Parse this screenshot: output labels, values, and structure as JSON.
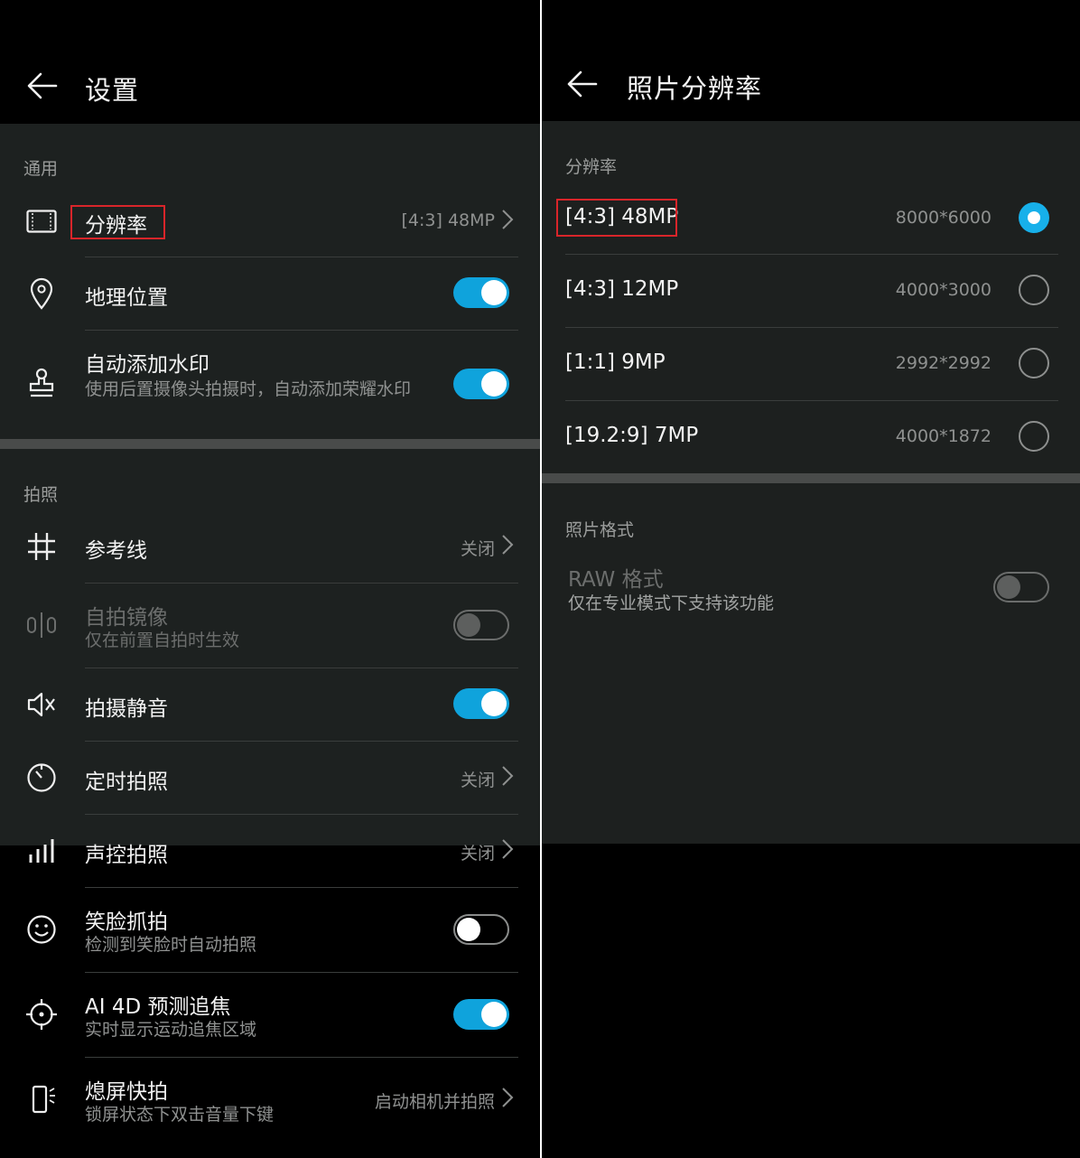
{
  "left": {
    "title": "设置",
    "sections": {
      "general": "通用",
      "photo": "拍照"
    },
    "rows": {
      "resolution": {
        "label": "分辨率",
        "value": "[4:3] 48MP"
      },
      "location": {
        "label": "地理位置",
        "toggle": "on"
      },
      "watermark": {
        "label": "自动添加水印",
        "sub": "使用后置摄像头拍摄时，自动添加荣耀水印",
        "toggle": "on"
      },
      "gridlines": {
        "label": "参考线",
        "value": "关闭"
      },
      "mirror": {
        "label": "自拍镜像",
        "sub": "仅在前置自拍时生效",
        "toggle": "off-disabled"
      },
      "mute": {
        "label": "拍摄静音",
        "toggle": "on"
      },
      "timer": {
        "label": "定时拍照",
        "value": "关闭"
      },
      "voice": {
        "label": "声控拍照",
        "value": "关闭"
      },
      "smile": {
        "label": "笑脸抓拍",
        "sub": "检测到笑脸时自动拍照",
        "toggle": "off"
      },
      "ai_focus": {
        "label": "AI 4D 预测追焦",
        "sub": "实时显示运动追焦区域",
        "toggle": "on"
      },
      "quick_snap": {
        "label": "熄屏快拍",
        "sub": "锁屏状态下双击音量下键",
        "value": "启动相机并拍照"
      }
    }
  },
  "right": {
    "title": "照片分辨率",
    "sections": {
      "resolution": "分辨率",
      "format": "照片格式"
    },
    "options": [
      {
        "label": "[4:3] 48MP",
        "value": "8000*6000",
        "selected": true
      },
      {
        "label": "[4:3] 12MP",
        "value": "4000*3000",
        "selected": false
      },
      {
        "label": "[1:1] 9MP",
        "value": "2992*2992",
        "selected": false
      },
      {
        "label": "[19.2:9] 7MP",
        "value": "4000*1872",
        "selected": false
      }
    ],
    "raw": {
      "label": "RAW 格式",
      "sub": "仅在专业模式下支持该功能",
      "toggle": "off-disabled"
    }
  },
  "colors": {
    "accent": "#0fa3dc",
    "highlight": "#d9252a",
    "sheet": "#1d2120"
  },
  "icons": {
    "resolution": "aspect-frame-icon",
    "location": "location-pin-icon",
    "watermark": "stamp-icon",
    "gridlines": "grid-icon",
    "mirror": "mirror-icon",
    "mute": "speaker-mute-icon",
    "timer": "timer-icon",
    "voice": "signal-bars-icon",
    "smile": "smiley-icon",
    "ai_focus": "crosshair-icon",
    "quick_snap": "phone-volume-icon"
  }
}
